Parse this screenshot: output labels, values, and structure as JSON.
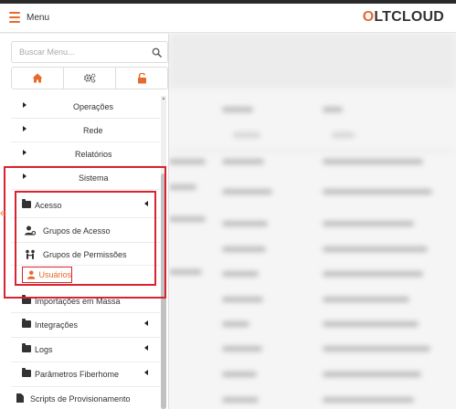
{
  "header": {
    "menu_label": "Menu",
    "logo_text_1": "O",
    "logo_text_2": "LTCLOUD",
    "accent_color": "#e8692c"
  },
  "sidebar": {
    "search_placeholder": "Buscar Menu...",
    "icon_buttons": [
      "home-icon",
      "cogs-icon",
      "unlock-icon"
    ],
    "items": [
      {
        "label": "Operações"
      },
      {
        "label": "Rede"
      },
      {
        "label": "Relatórios"
      },
      {
        "label": "Sistema"
      },
      {
        "label": "Acesso"
      },
      {
        "label": "Grupos de Acesso"
      },
      {
        "label": "Grupos de Permissões"
      },
      {
        "label": "Usuários"
      },
      {
        "label": "Importações em Massa"
      },
      {
        "label": "Integrações"
      },
      {
        "label": "Logs"
      },
      {
        "label": "Parâmetros Fiberhome"
      },
      {
        "label": "Scripts de Provisionamento"
      }
    ],
    "collapse_glyph": "«"
  }
}
